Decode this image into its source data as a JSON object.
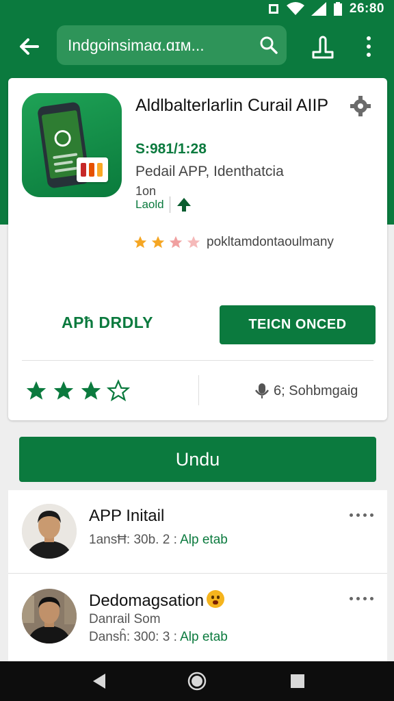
{
  "status_bar": {
    "time": "26:80"
  },
  "app_bar": {
    "search_text": "Indgoinsimaα.ɑɪм..."
  },
  "app": {
    "title": "Aldlbalterlarlin Curail AIIP",
    "price": "S:981/1:28",
    "subtitle": "Pedail APP, Identhatcia",
    "meta": "1on",
    "label": "Laold",
    "review_text": "pokltamdontaoulmany"
  },
  "actions": {
    "secondary_label": "APħ DRDLY",
    "primary_label": "TEICN ONCED"
  },
  "rating": {
    "stars_filled": 3,
    "stars_total": 4,
    "count_text": "6; Sohbmgaig"
  },
  "download_label": "Undu",
  "list": [
    {
      "title": "APP Initail",
      "meta": "1ansĦ: 30b. 2 :",
      "link": "Alp etab"
    },
    {
      "title": "Dedomagsation",
      "subtitle": "Danrail Som",
      "meta": "Dansĥ: 300: 3 :",
      "link": "Alp etab"
    }
  ],
  "colors": {
    "primary": "#0b7a3e",
    "background": "#eeeeee",
    "star": "#f5a623"
  },
  "icons": [
    "back-arrow-icon",
    "search-icon",
    "share-icon",
    "more-vert-icon",
    "settings-icon",
    "upload-arrow-icon",
    "star-icon",
    "mic-icon",
    "back-nav-icon",
    "home-nav-icon",
    "recents-nav-icon"
  ]
}
